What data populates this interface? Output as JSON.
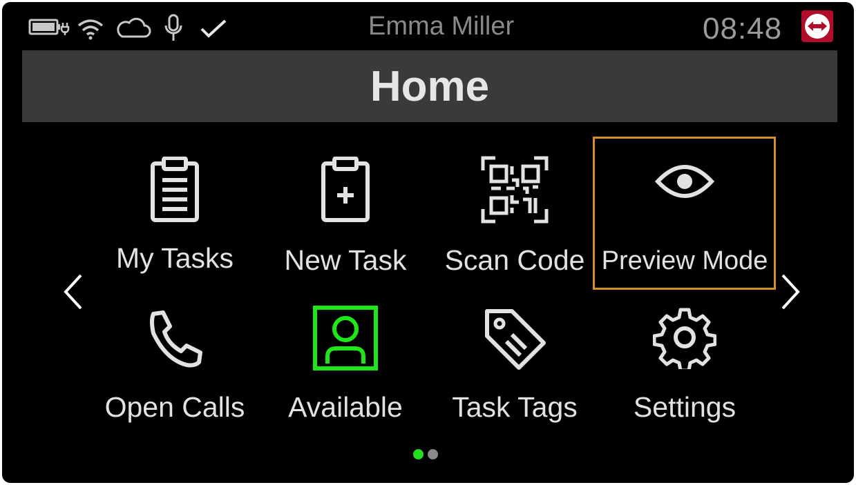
{
  "status_bar": {
    "user_name": "Emma Miller",
    "time": "08:48",
    "icons": [
      "battery-charging-icon",
      "wifi-icon",
      "cloud-icon",
      "microphone-icon",
      "check-icon",
      "teamviewer-icon"
    ]
  },
  "header": {
    "title": "Home"
  },
  "tiles": [
    {
      "label": "My Tasks",
      "icon": "clipboard-list-icon"
    },
    {
      "label": "New Task",
      "icon": "clipboard-plus-icon"
    },
    {
      "label": "Scan Code",
      "icon": "qr-code-icon"
    },
    {
      "label": "Preview Mode",
      "icon": "eye-icon",
      "highlighted": true
    },
    {
      "label": "Open Calls",
      "icon": "phone-icon"
    },
    {
      "label": "Available",
      "icon": "user-status-icon",
      "status_color": "#1ee619"
    },
    {
      "label": "Task Tags",
      "icon": "tag-icon"
    },
    {
      "label": "Settings",
      "icon": "gear-icon"
    }
  ],
  "pagination": {
    "pages": 2,
    "current": 1,
    "active_color": "#22dd22",
    "inactive_color": "#8a8a8a"
  },
  "colors": {
    "highlight": "#d4912a",
    "title_bar": "#3a3a3a",
    "teamviewer": "#b10d2a"
  }
}
